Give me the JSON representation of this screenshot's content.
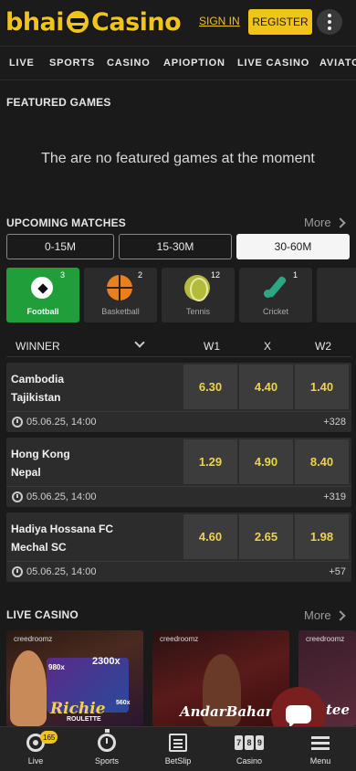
{
  "header": {
    "logo_left": "bhai",
    "logo_right": "Casino",
    "signin_label": "SIGN IN",
    "register_label": "REGISTER"
  },
  "nav": {
    "items": [
      "LIVE",
      "SPORTS",
      "CASINO",
      "APIOPTION",
      "LIVE CASINO",
      "AVIATOR"
    ]
  },
  "featured": {
    "title": "FEATURED GAMES",
    "empty_message": "The are no featured games at the moment"
  },
  "upcoming": {
    "title": "UPCOMING MATCHES",
    "more_label": "More",
    "tabs": [
      {
        "label": "0-15M",
        "active": false
      },
      {
        "label": "15-30M",
        "active": false
      },
      {
        "label": "30-60M",
        "active": true
      }
    ],
    "sports": [
      {
        "label": "Football",
        "count": "3",
        "icon": "football-icon",
        "active": true
      },
      {
        "label": "Basketball",
        "count": "2",
        "icon": "basketball-icon",
        "active": false
      },
      {
        "label": "Tennis",
        "count": "12",
        "icon": "tennis-icon",
        "active": false
      },
      {
        "label": "Cricket",
        "count": "1",
        "icon": "cricket-icon",
        "active": false
      }
    ],
    "market_label": "WINNER",
    "columns": [
      "W1",
      "X",
      "W2"
    ],
    "matches": [
      {
        "team1": "Cambodia",
        "team2": "Tajikistan",
        "odds": [
          "6.30",
          "4.40",
          "1.40"
        ],
        "date": "05.06.25, 14:00",
        "more": "+328"
      },
      {
        "team1": "Hong Kong",
        "team2": "Nepal",
        "odds": [
          "1.29",
          "4.90",
          "8.40"
        ],
        "date": "05.06.25, 14:00",
        "more": "+319"
      },
      {
        "team1": "Hadiya Hossana FC",
        "team2": "Mechal SC",
        "odds": [
          "4.60",
          "2.65",
          "1.98"
        ],
        "date": "05.06.25, 14:00",
        "more": "+57"
      }
    ]
  },
  "live_casino": {
    "title": "LIVE CASINO",
    "more_label": "More",
    "cards": [
      {
        "brand": "creedroomz",
        "name": "Richie",
        "sub": "ROULETTE",
        "chip1": "2300x",
        "chip2": "980x",
        "chip3": "560x"
      },
      {
        "brand": "creedroomz",
        "name": "AndarBahar"
      },
      {
        "brand": "creedroomz",
        "name": "tee"
      }
    ]
  },
  "bottom_nav": {
    "items": [
      {
        "label": "Live",
        "badge": "165"
      },
      {
        "label": "Sports"
      },
      {
        "label": "BetSlip"
      },
      {
        "label": "Casino",
        "digits": [
          "7",
          "8",
          "9"
        ]
      },
      {
        "label": "Menu"
      }
    ]
  },
  "colors": {
    "accent": "#f0c419",
    "active_sport": "#1f9e3a",
    "odds_text": "#f0d34a",
    "background": "#1a1a1a"
  }
}
